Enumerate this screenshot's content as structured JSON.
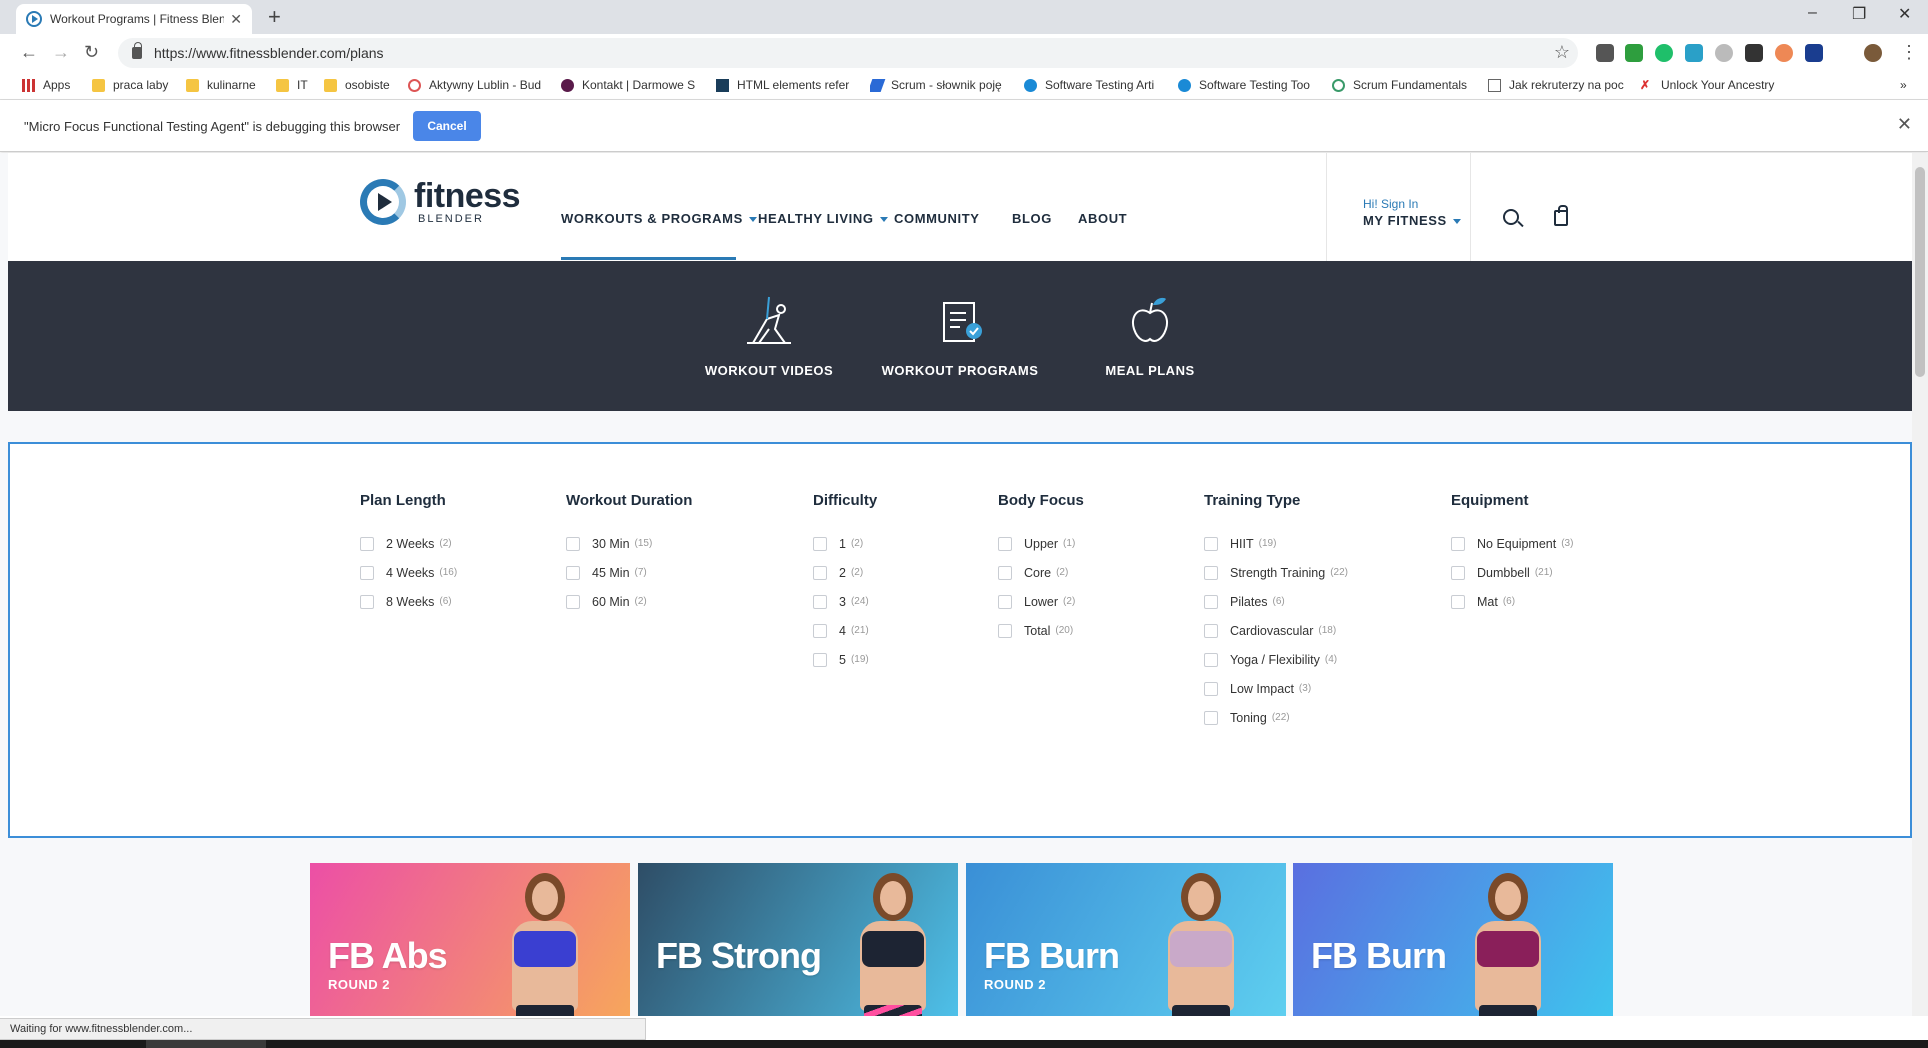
{
  "browser": {
    "tab_title": "Workout Programs | Fitness Blender",
    "url": "https://www.fitnessblender.com/plans",
    "bookmarks": [
      {
        "label": "Apps",
        "icon": "apps-grid-icon"
      },
      {
        "label": "praca laby",
        "icon": "folder-icon"
      },
      {
        "label": "kulinarne",
        "icon": "folder-icon"
      },
      {
        "label": "IT",
        "icon": "folder-icon"
      },
      {
        "label": "osobiste",
        "icon": "folder-icon"
      },
      {
        "label": "Aktywny Lublin - Bud",
        "icon": "site-icon"
      },
      {
        "label": "Kontakt | Darmowe S",
        "icon": "site-icon"
      },
      {
        "label": "HTML elements refer",
        "icon": "site-icon"
      },
      {
        "label": "Scrum - słownik poję",
        "icon": "site-icon"
      },
      {
        "label": "Software Testing Arti",
        "icon": "site-icon"
      },
      {
        "label": "Software Testing Too",
        "icon": "site-icon"
      },
      {
        "label": "Scrum Fundamentals",
        "icon": "site-icon"
      },
      {
        "label": "Jak rekruterzy na poc",
        "icon": "page-icon"
      },
      {
        "label": "Unlock Your Ancestry",
        "icon": "site-icon"
      }
    ],
    "debug_message": "\"Micro Focus Functional Testing Agent\" is debugging this browser",
    "debug_cancel": "Cancel",
    "status_text": "Waiting for www.fitnessblender.com..."
  },
  "site": {
    "logo_word": "fitness",
    "logo_sub": "BLENDER",
    "nav": [
      "WORKOUTS & PROGRAMS",
      "HEALTHY LIVING",
      "COMMUNITY",
      "BLOG",
      "ABOUT"
    ],
    "signin_greeting": "Hi! Sign In",
    "my_fitness": "MY FITNESS",
    "accent_color": "#2a7ab5",
    "banner_color": "#2f3440"
  },
  "categories": [
    "WORKOUT VIDEOS",
    "WORKOUT PROGRAMS",
    "MEAL PLANS"
  ],
  "filters": [
    {
      "title": "Plan Length",
      "options": [
        {
          "label": "2 Weeks",
          "count": "(2)"
        },
        {
          "label": "4 Weeks",
          "count": "(16)"
        },
        {
          "label": "8 Weeks",
          "count": "(6)"
        }
      ]
    },
    {
      "title": "Workout Duration",
      "options": [
        {
          "label": "30 Min",
          "count": "(15)"
        },
        {
          "label": "45 Min",
          "count": "(7)"
        },
        {
          "label": "60 Min",
          "count": "(2)"
        }
      ]
    },
    {
      "title": "Difficulty",
      "options": [
        {
          "label": "1",
          "count": "(2)"
        },
        {
          "label": "2",
          "count": "(2)"
        },
        {
          "label": "3",
          "count": "(24)"
        },
        {
          "label": "4",
          "count": "(21)"
        },
        {
          "label": "5",
          "count": "(19)"
        }
      ]
    },
    {
      "title": "Body Focus",
      "options": [
        {
          "label": "Upper",
          "count": "(1)"
        },
        {
          "label": "Core",
          "count": "(2)"
        },
        {
          "label": "Lower",
          "count": "(2)"
        },
        {
          "label": "Total",
          "count": "(20)"
        }
      ]
    },
    {
      "title": "Training Type",
      "options": [
        {
          "label": "HIIT",
          "count": "(19)"
        },
        {
          "label": "Strength Training",
          "count": "(22)"
        },
        {
          "label": "Pilates",
          "count": "(6)"
        },
        {
          "label": "Cardiovascular",
          "count": "(18)"
        },
        {
          "label": "Yoga / Flexibility",
          "count": "(4)"
        },
        {
          "label": "Low Impact",
          "count": "(3)"
        },
        {
          "label": "Toning",
          "count": "(22)"
        }
      ]
    },
    {
      "title": "Equipment",
      "options": [
        {
          "label": "No Equipment",
          "count": "(3)"
        },
        {
          "label": "Dumbbell",
          "count": "(21)"
        },
        {
          "label": "Mat",
          "count": "(6)"
        }
      ]
    }
  ],
  "programs": [
    {
      "title": "FB Abs",
      "subtitle": "ROUND 2",
      "gradient_from": "#ec4fa6",
      "gradient_to": "#f7a85a",
      "top_color": "#3a3fd1"
    },
    {
      "title": "FB Strong",
      "subtitle": "",
      "gradient_from": "#2e4d66",
      "gradient_to": "#4fc3ec",
      "top_color": "#1d2433"
    },
    {
      "title": "FB Burn",
      "subtitle": "ROUND 2",
      "gradient_from": "#3a8fd6",
      "gradient_to": "#5fd0f0",
      "top_color": "#c9a9c9"
    },
    {
      "title": "FB Burn",
      "subtitle": "",
      "gradient_from": "#5a6fe0",
      "gradient_to": "#3ec6ee",
      "top_color": "#8a1f5a"
    }
  ]
}
